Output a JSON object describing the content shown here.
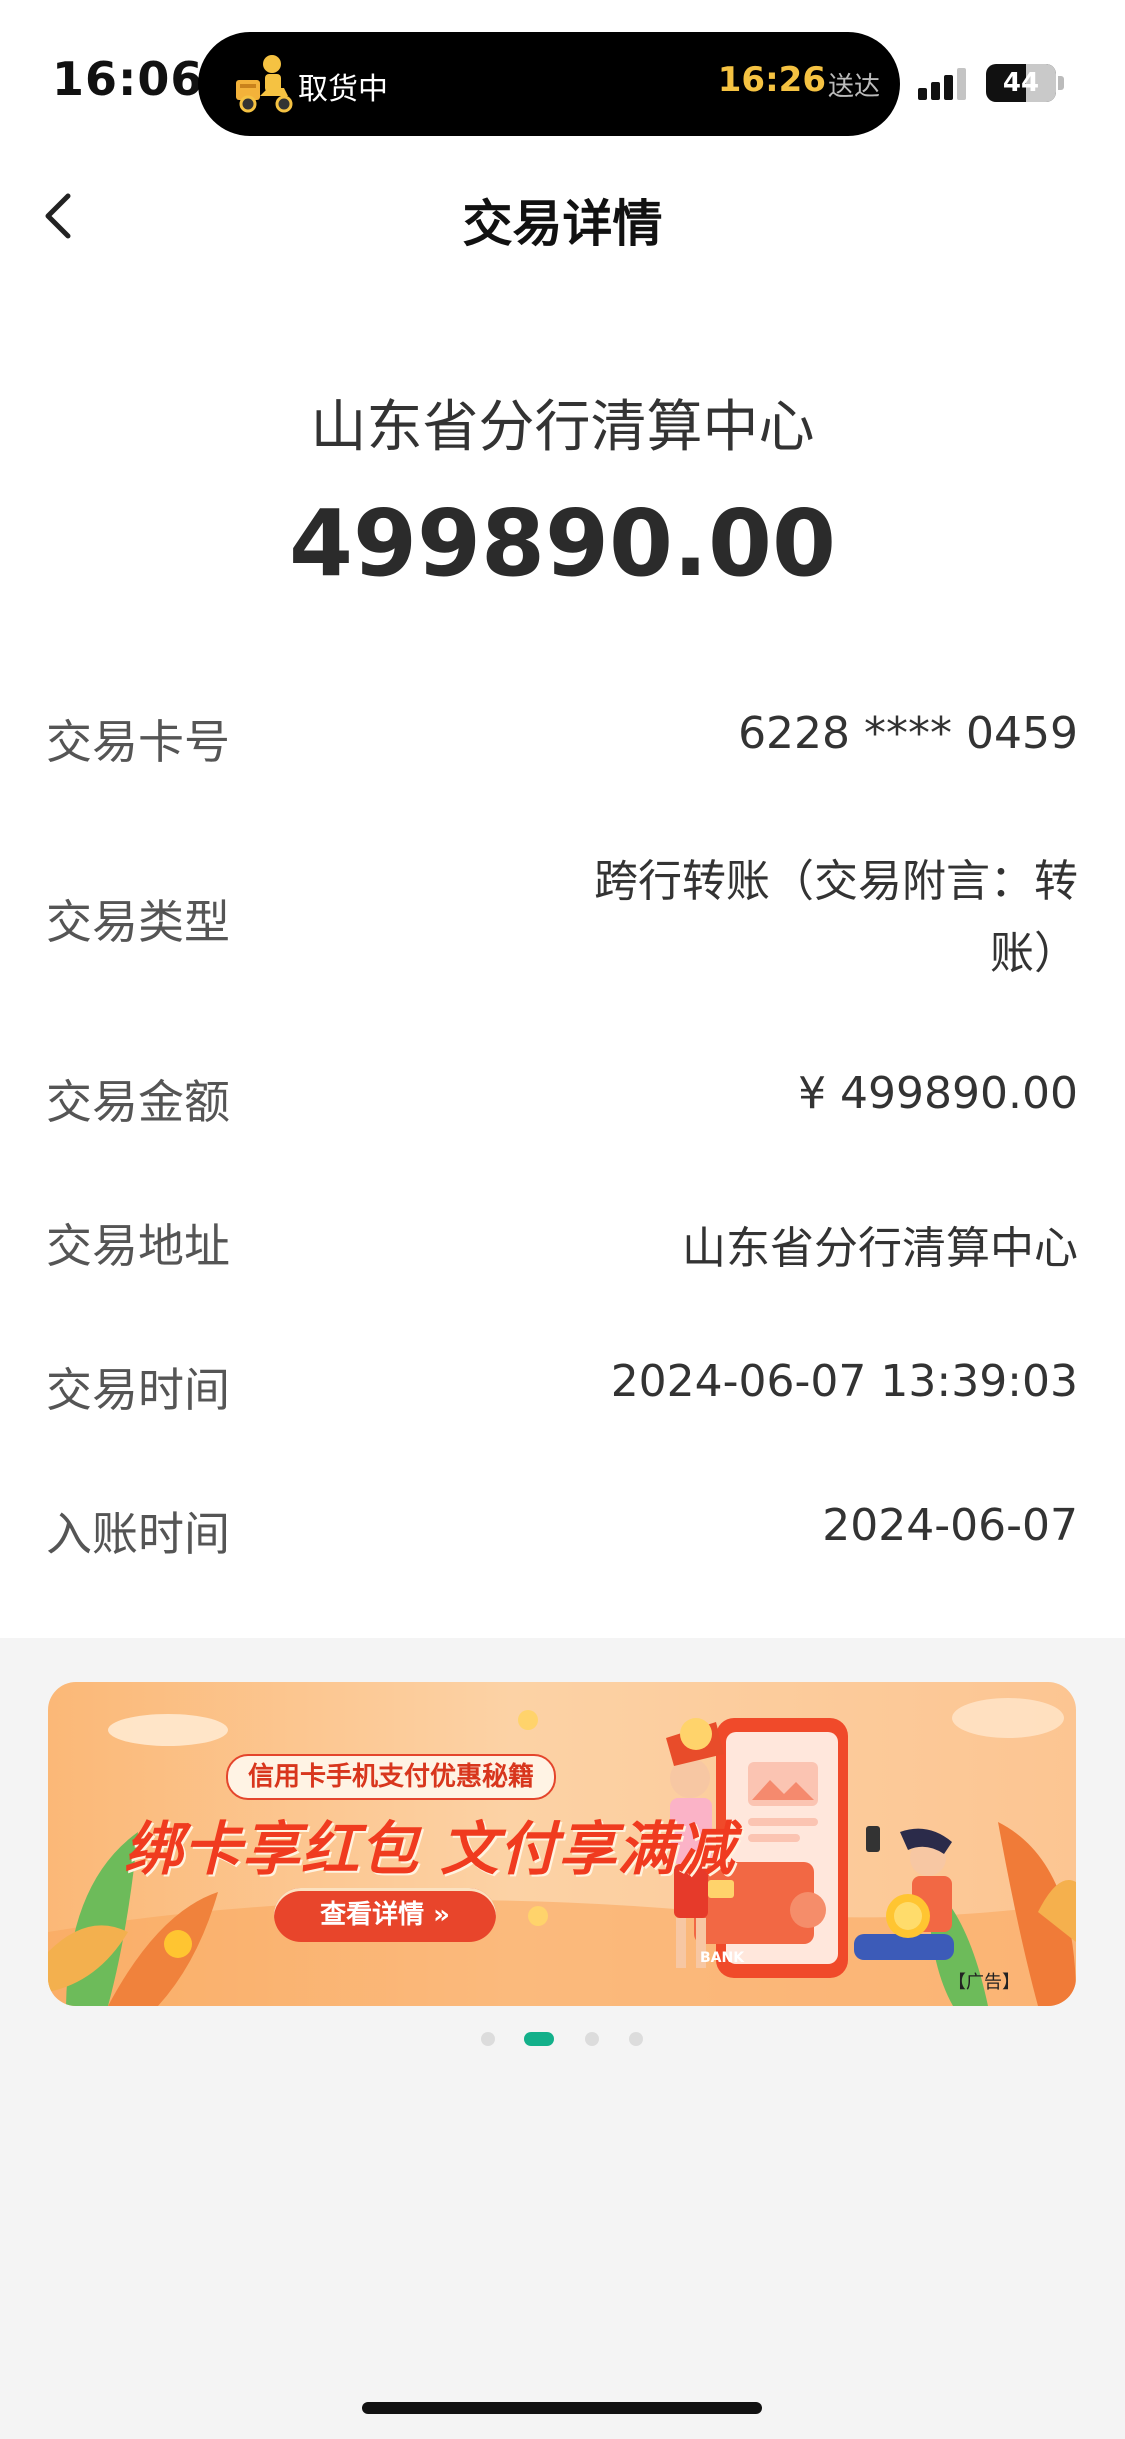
{
  "status_bar": {
    "time": "16:06",
    "island_status": "取货中",
    "island_time": "16:26",
    "island_suffix": "送达",
    "battery": "44",
    "battery_level_percent": 44
  },
  "nav": {
    "title": "交易详情"
  },
  "header": {
    "payee": "山东省分行清算中心",
    "amount": "499890.00"
  },
  "details": [
    {
      "label": "交易卡号",
      "value": "6228 **** 0459"
    },
    {
      "label": "交易类型",
      "value_line1": "跨行转账（交易附言：转",
      "value_line2": "账）"
    },
    {
      "label": "交易金额",
      "value": "¥ 499890.00"
    },
    {
      "label": "交易地址",
      "value": "山东省分行清算中心"
    },
    {
      "label": "交易时间",
      "value": "2024-06-07 13:39:03"
    },
    {
      "label": "入账时间",
      "value": "2024-06-07"
    }
  ],
  "banner": {
    "subtitle": "信用卡手机支付优惠秘籍",
    "headline": "绑卡享红包 文付享满减",
    "button": "查看详情 »",
    "card_text": "BANK",
    "ad_tag": "【广告】"
  },
  "carousel": {
    "count": 4,
    "active_index": 1
  },
  "colors": {
    "accent": "#13b08a",
    "banner_red": "#f03b1f",
    "island_time": "#f5c242"
  }
}
